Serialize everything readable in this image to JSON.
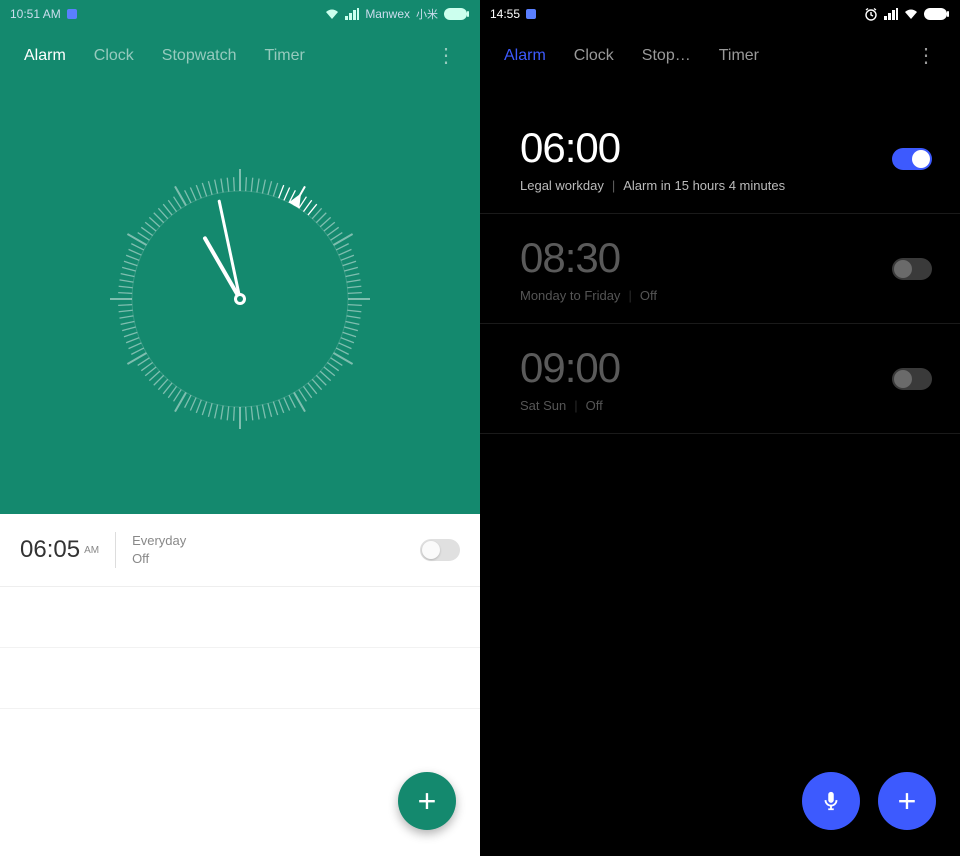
{
  "left": {
    "status": {
      "time": "10:51 AM",
      "carrier": "Manwex",
      "carrier_cn": "小米"
    },
    "tabs": {
      "alarm": "Alarm",
      "clock": "Clock",
      "stopwatch": "Stopwatch",
      "timer": "Timer"
    },
    "alarm": {
      "time": "06:05",
      "ampm": "AM",
      "repeat": "Everyday",
      "state": "Off",
      "enabled": false
    },
    "fab": {
      "icon": "plus"
    },
    "colors": {
      "bg": "#14896e"
    }
  },
  "right": {
    "status": {
      "time": "14:55"
    },
    "tabs": {
      "alarm": "Alarm",
      "clock": "Clock",
      "stopwatch": "Stop…",
      "timer": "Timer"
    },
    "alarms": [
      {
        "time": "06:00",
        "repeat": "Legal workday",
        "detail": "Alarm in 15 hours 4 minutes",
        "enabled": true
      },
      {
        "time": "08:30",
        "repeat": "Monday to Friday",
        "detail": "Off",
        "enabled": false
      },
      {
        "time": "09:00",
        "repeat": "Sat Sun",
        "detail": "Off",
        "enabled": false
      }
    ],
    "fab": {
      "mic": "mic",
      "add": "plus"
    },
    "colors": {
      "accent": "#3d5afe"
    }
  }
}
